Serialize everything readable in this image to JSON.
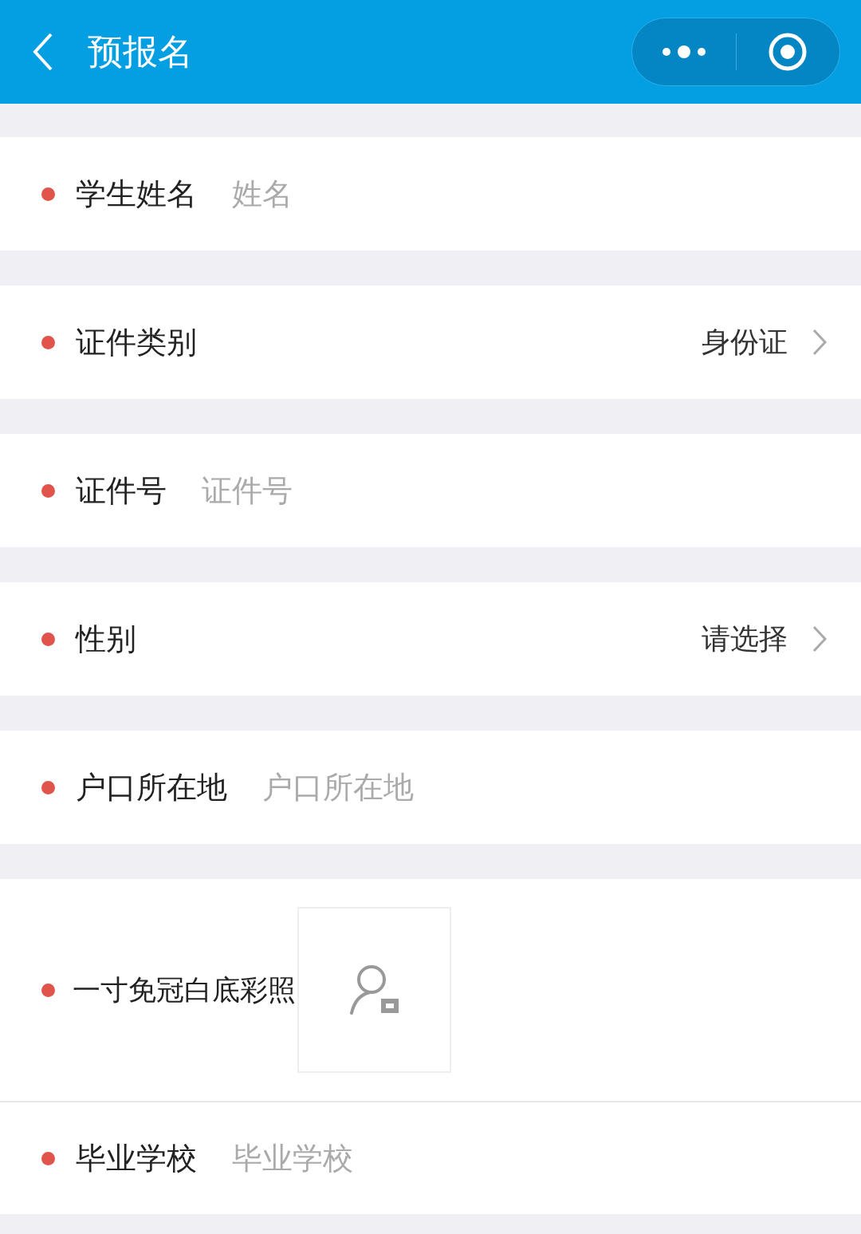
{
  "header": {
    "title": "预报名"
  },
  "fields": [
    {
      "kind": "input",
      "label": "学生姓名",
      "required": true,
      "placeholder": "姓名"
    },
    {
      "kind": "select",
      "label": "证件类别",
      "required": true,
      "value": "身份证"
    },
    {
      "kind": "input",
      "label": "证件号",
      "required": true,
      "placeholder": "证件号"
    },
    {
      "kind": "select",
      "label": "性别",
      "required": true,
      "value": "请选择"
    },
    {
      "kind": "input",
      "label": "户口所在地",
      "required": true,
      "placeholder": "户口所在地"
    },
    {
      "kind": "photo",
      "label": "一寸免冠白底彩照",
      "required": true
    },
    {
      "kind": "input",
      "label": "毕业学校",
      "required": true,
      "placeholder": "毕业学校"
    }
  ]
}
